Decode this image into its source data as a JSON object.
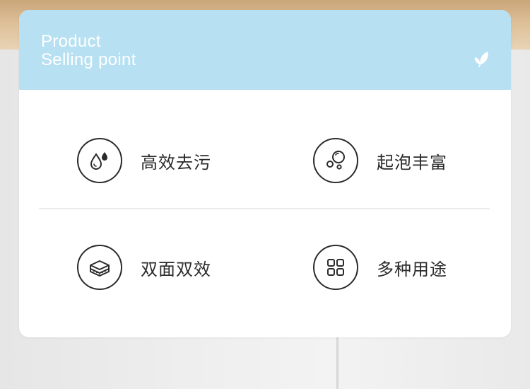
{
  "header": {
    "title_line1": "Product",
    "title_line2": "Selling point",
    "icon": "leaf-icon"
  },
  "colors": {
    "header_bg": "#b7e0f2",
    "card_bg": "#ffffff",
    "text": "#2b2b2b"
  },
  "features": [
    {
      "label": "高效去污",
      "icon": "water-drops-icon"
    },
    {
      "label": "起泡丰富",
      "icon": "bubbles-icon"
    },
    {
      "label": "双面双效",
      "icon": "sponge-icon"
    },
    {
      "label": "多种用途",
      "icon": "grid-icon"
    }
  ]
}
